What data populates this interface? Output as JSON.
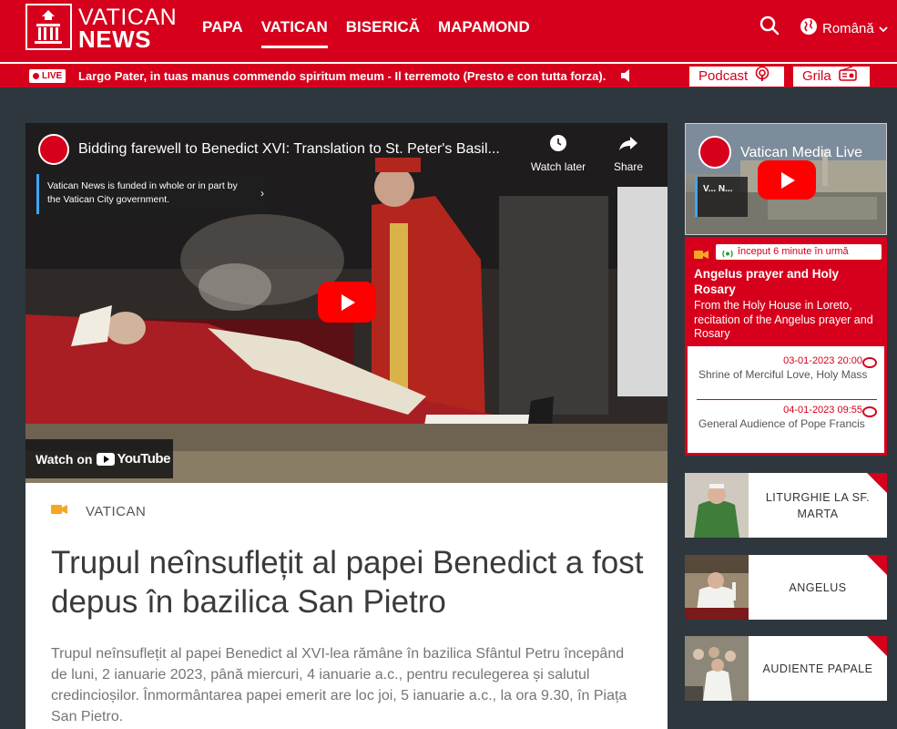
{
  "header": {
    "logo_line1": "VATICAN",
    "logo_line2": "NEWS",
    "nav": [
      "PAPA",
      "VATICAN",
      "BISERICĂ",
      "MAPAMOND"
    ],
    "active_nav_index": 1,
    "language": "Română",
    "brand_color": "#d6001c"
  },
  "live": {
    "badge": "LIVE",
    "text": "Largo Pater, in tuas manus commendo spiritum meum - Il terremoto (Presto e con tutta forza).",
    "podcast": "Podcast",
    "grila": "Grila"
  },
  "video": {
    "title": "Bidding farewell to Benedict XVI: Translation to St. Peter's Basil...",
    "watch_later": "Watch later",
    "share": "Share",
    "funded_notice": "Vatican News is funded in whole or in part by the Vatican City government.",
    "watch_on": "Watch on",
    "youtube": "YouTube"
  },
  "article": {
    "section": "VATICAN",
    "title": "Trupul neînsuflețit al papei Benedict a fost depus în bazilica San Pietro",
    "lead": "Trupul neînsuflețit al papei Benedict al XVI-lea rămâne în bazilica Sfântul Petru începând de luni, 2 ianuarie 2023, până miercuri, 4 ianuarie a.c., pentru reculegerea și salutul credincioșilor. Înmormântarea papei emerit are loc joi, 5 ianuarie a.c., la ora 9.30, în Piața San Pietro."
  },
  "side_video": {
    "title": "Vatican Media Live",
    "funded_short": "V... N..."
  },
  "schedule": {
    "badge": "început 6 minute în urmă",
    "title": "Angelus prayer and Holy Rosary",
    "description": "From the Holy House in Loreto, recitation of the Angelus prayer and Rosary",
    "items": [
      {
        "time": "03-01-2023 20:00",
        "name": "Shrine of Merciful Love, Holy Mass"
      },
      {
        "time": "04-01-2023 09:55",
        "name": "General Audience of Pope Francis"
      }
    ]
  },
  "features": [
    {
      "label": "LITURGHIE LA SF. MARTA"
    },
    {
      "label": "ANGELUS"
    },
    {
      "label": "AUDIENTE PAPALE"
    }
  ]
}
